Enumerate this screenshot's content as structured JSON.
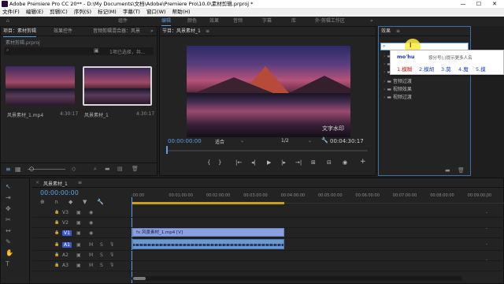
{
  "window": {
    "title": "Adobe Premiere Pro CC 20** - D:\\My Documents\\文档\\Adobe\\Premiere Pro\\10.0\\素材剪辑.prproj *",
    "controls": [
      "—",
      "☐",
      "✕"
    ]
  },
  "menu": [
    "文件(F)",
    "编辑(E)",
    "剪辑(C)",
    "序列(S)",
    "标记(M)",
    "字幕(T)",
    "窗口(W)",
    "帮助(H)"
  ],
  "workspaces": [
    "组件",
    "编辑",
    "颜色",
    "效果",
    "音频",
    "字幕",
    "库",
    "外·剪辑工作区"
  ],
  "workspace_more": "»",
  "project": {
    "tabs": [
      "项目：素材剪辑",
      "效果控件",
      "音频剪辑混合器：风景",
      "»"
    ],
    "file": "素材剪辑.prproj",
    "selection_info": "1项已选择，共...",
    "clips": [
      {
        "name": "风景素材_1.mp4",
        "duration": "4:30:17"
      },
      {
        "name": "风景素材_1",
        "duration": "4:30:17"
      }
    ]
  },
  "program": {
    "tab": "节目：风景素材_1",
    "menu_icon": "≡",
    "watermark": "文字水印",
    "timecode": "00:00:00:00",
    "fit": "适合",
    "resolution": "1/2",
    "duration": "00:04:30:17"
  },
  "effects": {
    "tab": "效果",
    "menu_icon": "≡",
    "search_value": "",
    "folders": [
      "",
      "",
      "",
      "音频过渡",
      "视频效果",
      "视频过渡"
    ]
  },
  "ime": {
    "pinyin": "mo'hu",
    "hint": "按分号(;)提示更多人名",
    "candidates": [
      "1.模糊",
      "2.模胡",
      "3.莫",
      "4.魔",
      "5.摸"
    ]
  },
  "timeline": {
    "tab": "风景素材_1",
    "menu_icon": "≡",
    "timecode": "00:00:00:00",
    "ruler": [
      ":00:00",
      "00:01:00:00",
      "00:02:00:00",
      "00:03:00:00",
      "00:04:00:00",
      "00:05:00:00",
      "00:06:00:00",
      "00:07:00:00",
      "00:08:00:00",
      "00:09:00:00"
    ],
    "tracks": [
      "V3",
      "V2",
      "V1",
      "A1",
      "A2",
      "A3"
    ],
    "video_clip": "风景素材_1.mp4 [V]",
    "track_letters": {
      "mute": "M",
      "solo": "S"
    }
  }
}
